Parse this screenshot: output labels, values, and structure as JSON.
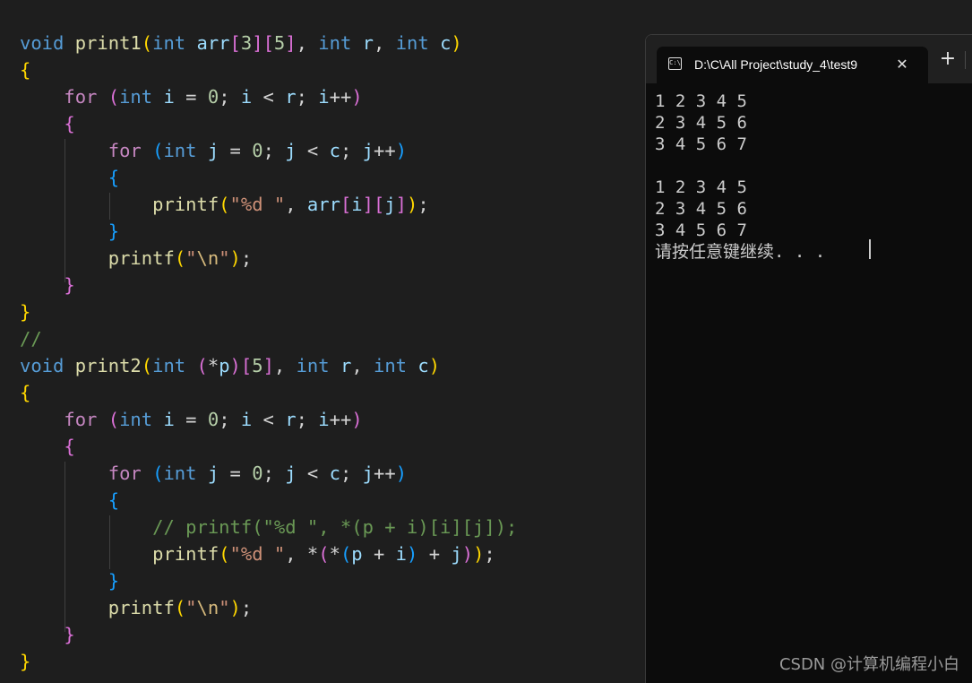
{
  "editor": {
    "lines": [
      [
        [
          "void",
          "kw"
        ],
        [
          " ",
          "pl"
        ],
        [
          "print1",
          "fn"
        ],
        [
          "(",
          "b1"
        ],
        [
          "int",
          "kw"
        ],
        [
          " ",
          "pl"
        ],
        [
          "arr",
          "var"
        ],
        [
          "[",
          "b2"
        ],
        [
          "3",
          "num"
        ],
        [
          "]",
          "b2"
        ],
        [
          "[",
          "b2"
        ],
        [
          "5",
          "num"
        ],
        [
          "]",
          "b2"
        ],
        [
          ", ",
          "pl"
        ],
        [
          "int",
          "kw"
        ],
        [
          " ",
          "pl"
        ],
        [
          "r",
          "var"
        ],
        [
          ", ",
          "pl"
        ],
        [
          "int",
          "kw"
        ],
        [
          " ",
          "pl"
        ],
        [
          "c",
          "var"
        ],
        [
          ")",
          "b1"
        ]
      ],
      [
        [
          "{",
          "b1"
        ]
      ],
      [
        [
          "    ",
          "pl"
        ],
        [
          "for",
          "ctl"
        ],
        [
          " ",
          "pl"
        ],
        [
          "(",
          "b2"
        ],
        [
          "int",
          "kw"
        ],
        [
          " ",
          "pl"
        ],
        [
          "i",
          "var"
        ],
        [
          " = ",
          "pl"
        ],
        [
          "0",
          "num"
        ],
        [
          "; ",
          "pl"
        ],
        [
          "i",
          "var"
        ],
        [
          " < ",
          "pl"
        ],
        [
          "r",
          "var"
        ],
        [
          "; ",
          "pl"
        ],
        [
          "i",
          "var"
        ],
        [
          "++",
          "pl"
        ],
        [
          ")",
          "b2"
        ]
      ],
      [
        [
          "    ",
          "pl"
        ],
        [
          "{",
          "b2"
        ]
      ],
      [
        [
          "        ",
          "pl"
        ],
        [
          "for",
          "ctl"
        ],
        [
          " ",
          "pl"
        ],
        [
          "(",
          "b3"
        ],
        [
          "int",
          "kw"
        ],
        [
          " ",
          "pl"
        ],
        [
          "j",
          "var"
        ],
        [
          " = ",
          "pl"
        ],
        [
          "0",
          "num"
        ],
        [
          "; ",
          "pl"
        ],
        [
          "j",
          "var"
        ],
        [
          " < ",
          "pl"
        ],
        [
          "c",
          "var"
        ],
        [
          "; ",
          "pl"
        ],
        [
          "j",
          "var"
        ],
        [
          "++",
          "pl"
        ],
        [
          ")",
          "b3"
        ]
      ],
      [
        [
          "        ",
          "pl"
        ],
        [
          "{",
          "b3"
        ]
      ],
      [
        [
          "            ",
          "pl"
        ],
        [
          "printf",
          "fn"
        ],
        [
          "(",
          "b1"
        ],
        [
          "\"%d \"",
          "str"
        ],
        [
          ", ",
          "pl"
        ],
        [
          "arr",
          "var"
        ],
        [
          "[",
          "b2"
        ],
        [
          "i",
          "var"
        ],
        [
          "]",
          "b2"
        ],
        [
          "[",
          "b2"
        ],
        [
          "j",
          "var"
        ],
        [
          "]",
          "b2"
        ],
        [
          ")",
          "b1"
        ],
        [
          ";",
          "pl"
        ]
      ],
      [
        [
          "        ",
          "pl"
        ],
        [
          "}",
          "b3"
        ]
      ],
      [
        [
          "        ",
          "pl"
        ],
        [
          "printf",
          "fn"
        ],
        [
          "(",
          "b1"
        ],
        [
          "\"",
          "str"
        ],
        [
          "\\n",
          "esc"
        ],
        [
          "\"",
          "str"
        ],
        [
          ")",
          "b1"
        ],
        [
          ";",
          "pl"
        ]
      ],
      [
        [
          "    ",
          "pl"
        ],
        [
          "}",
          "b2"
        ]
      ],
      [
        [
          "}",
          "b1"
        ]
      ],
      [
        [
          "//",
          "cmt"
        ]
      ],
      [
        [
          "void",
          "kw"
        ],
        [
          " ",
          "pl"
        ],
        [
          "print2",
          "fn"
        ],
        [
          "(",
          "b1"
        ],
        [
          "int",
          "kw"
        ],
        [
          " ",
          "pl"
        ],
        [
          "(",
          "b2"
        ],
        [
          "*",
          "pl"
        ],
        [
          "p",
          "var"
        ],
        [
          ")",
          "b2"
        ],
        [
          "[",
          "b2"
        ],
        [
          "5",
          "num"
        ],
        [
          "]",
          "b2"
        ],
        [
          ", ",
          "pl"
        ],
        [
          "int",
          "kw"
        ],
        [
          " ",
          "pl"
        ],
        [
          "r",
          "var"
        ],
        [
          ", ",
          "pl"
        ],
        [
          "int",
          "kw"
        ],
        [
          " ",
          "pl"
        ],
        [
          "c",
          "var"
        ],
        [
          ")",
          "b1"
        ]
      ],
      [
        [
          "{",
          "b1"
        ]
      ],
      [
        [
          "    ",
          "pl"
        ],
        [
          "for",
          "ctl"
        ],
        [
          " ",
          "pl"
        ],
        [
          "(",
          "b2"
        ],
        [
          "int",
          "kw"
        ],
        [
          " ",
          "pl"
        ],
        [
          "i",
          "var"
        ],
        [
          " = ",
          "pl"
        ],
        [
          "0",
          "num"
        ],
        [
          "; ",
          "pl"
        ],
        [
          "i",
          "var"
        ],
        [
          " < ",
          "pl"
        ],
        [
          "r",
          "var"
        ],
        [
          "; ",
          "pl"
        ],
        [
          "i",
          "var"
        ],
        [
          "++",
          "pl"
        ],
        [
          ")",
          "b2"
        ]
      ],
      [
        [
          "    ",
          "pl"
        ],
        [
          "{",
          "b2"
        ]
      ],
      [
        [
          "        ",
          "pl"
        ],
        [
          "for",
          "ctl"
        ],
        [
          " ",
          "pl"
        ],
        [
          "(",
          "b3"
        ],
        [
          "int",
          "kw"
        ],
        [
          " ",
          "pl"
        ],
        [
          "j",
          "var"
        ],
        [
          " = ",
          "pl"
        ],
        [
          "0",
          "num"
        ],
        [
          "; ",
          "pl"
        ],
        [
          "j",
          "var"
        ],
        [
          " < ",
          "pl"
        ],
        [
          "c",
          "var"
        ],
        [
          "; ",
          "pl"
        ],
        [
          "j",
          "var"
        ],
        [
          "++",
          "pl"
        ],
        [
          ")",
          "b3"
        ]
      ],
      [
        [
          "        ",
          "pl"
        ],
        [
          "{",
          "b3"
        ]
      ],
      [
        [
          "            ",
          "pl"
        ],
        [
          "// printf(\"%d \", *(p + i)[i][j]);",
          "cmt"
        ]
      ],
      [
        [
          "            ",
          "pl"
        ],
        [
          "printf",
          "fn"
        ],
        [
          "(",
          "b1"
        ],
        [
          "\"%d \"",
          "str"
        ],
        [
          ", ",
          "pl"
        ],
        [
          "*",
          "pl"
        ],
        [
          "(",
          "b2"
        ],
        [
          "*",
          "pl"
        ],
        [
          "(",
          "b3"
        ],
        [
          "p",
          "var"
        ],
        [
          " + ",
          "pl"
        ],
        [
          "i",
          "var"
        ],
        [
          ")",
          "b3"
        ],
        [
          " + ",
          "pl"
        ],
        [
          "j",
          "var"
        ],
        [
          ")",
          "b2"
        ],
        [
          ")",
          "b1"
        ],
        [
          ";",
          "pl"
        ]
      ],
      [
        [
          "        ",
          "pl"
        ],
        [
          "}",
          "b3"
        ]
      ],
      [
        [
          "        ",
          "pl"
        ],
        [
          "printf",
          "fn"
        ],
        [
          "(",
          "b1"
        ],
        [
          "\"",
          "str"
        ],
        [
          "\\n",
          "esc"
        ],
        [
          "\"",
          "str"
        ],
        [
          ")",
          "b1"
        ],
        [
          ";",
          "pl"
        ]
      ],
      [
        [
          "    ",
          "pl"
        ],
        [
          "}",
          "b2"
        ]
      ],
      [
        [
          "}",
          "b1"
        ]
      ]
    ]
  },
  "terminal": {
    "tab_title": "D:\\C\\All Project\\study_4\\test9",
    "tab_icon_glyph": "C:\\",
    "close_glyph": "✕",
    "new_tab_glyph": "+",
    "output_lines": [
      "1 2 3 4 5",
      "2 3 4 5 6",
      "3 4 5 6 7",
      "",
      "1 2 3 4 5",
      "2 3 4 5 6",
      "3 4 5 6 7",
      "请按任意键继续. . ."
    ]
  },
  "watermark": "CSDN @计算机编程小白"
}
